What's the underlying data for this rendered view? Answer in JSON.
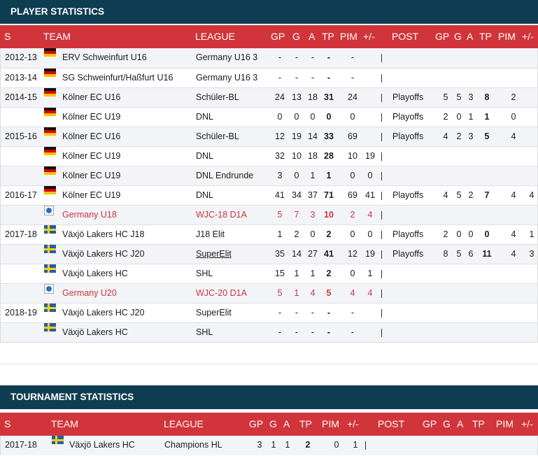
{
  "player_section": {
    "title": "PLAYER STATISTICS",
    "headers": {
      "season": "S",
      "team": "TEAM",
      "league": "LEAGUE",
      "gp": "GP",
      "g": "G",
      "a": "A",
      "tp": "TP",
      "pim": "PIM",
      "pm": "+/-",
      "post": "POST",
      "pgp": "GP",
      "pg": "G",
      "pa": "A",
      "ptp": "TP",
      "ppim": "PIM",
      "ppm": "+/-"
    },
    "rows": [
      {
        "season": "2012-13",
        "flag": "germany-flag",
        "team": "ERV Schweinfurt U16",
        "league": "Germany U16 3",
        "gp": "-",
        "g": "-",
        "a": "-",
        "tp": "-",
        "pim": "-",
        "pm": "",
        "sep": "|",
        "post": "",
        "pgp": "",
        "pg": "",
        "pa": "",
        "ptp": "",
        "ppim": "",
        "ppm": "",
        "red": false
      },
      {
        "season": "2013-14",
        "flag": "germany-flag",
        "team": "SG Schweinfurt/Haßfurt U16",
        "league": "Germany U16 3",
        "gp": "-",
        "g": "-",
        "a": "-",
        "tp": "-",
        "pim": "-",
        "pm": "",
        "sep": "|",
        "post": "",
        "pgp": "",
        "pg": "",
        "pa": "",
        "ptp": "",
        "ppim": "",
        "ppm": "",
        "red": false
      },
      {
        "season": "2014-15",
        "flag": "germany-flag",
        "team": "Kölner EC U16",
        "league": "Schüler-BL",
        "gp": "24",
        "g": "13",
        "a": "18",
        "tp": "31",
        "pim": "24",
        "pm": "",
        "sep": "|",
        "post": "Playoffs",
        "pgp": "5",
        "pg": "5",
        "pa": "3",
        "ptp": "8",
        "ppim": "2",
        "ppm": "",
        "red": false
      },
      {
        "season": "",
        "flag": "germany-flag",
        "team": "Kölner EC U19",
        "league": "DNL",
        "gp": "0",
        "g": "0",
        "a": "0",
        "tp": "0",
        "pim": "0",
        "pm": "",
        "sep": "|",
        "post": "Playoffs",
        "pgp": "2",
        "pg": "0",
        "pa": "1",
        "ptp": "1",
        "ppim": "0",
        "ppm": "",
        "red": false
      },
      {
        "season": "2015-16",
        "flag": "germany-flag",
        "team": "Kölner EC U16",
        "league": "Schüler-BL",
        "gp": "12",
        "g": "19",
        "a": "14",
        "tp": "33",
        "pim": "69",
        "pm": "",
        "sep": "|",
        "post": "Playoffs",
        "pgp": "4",
        "pg": "2",
        "pa": "3",
        "ptp": "5",
        "ppim": "4",
        "ppm": "",
        "red": false
      },
      {
        "season": "",
        "flag": "germany-flag",
        "team": "Kölner EC U19",
        "league": "DNL",
        "gp": "32",
        "g": "10",
        "a": "18",
        "tp": "28",
        "pim": "10",
        "pm": "19",
        "sep": "|",
        "post": "",
        "pgp": "",
        "pg": "",
        "pa": "",
        "ptp": "",
        "ppim": "",
        "ppm": "",
        "red": false
      },
      {
        "season": "",
        "flag": "germany-flag",
        "team": "Kölner EC U19",
        "league": "DNL Endrunde",
        "gp": "3",
        "g": "0",
        "a": "1",
        "tp": "1",
        "pim": "0",
        "pm": "0",
        "sep": "|",
        "post": "",
        "pgp": "",
        "pg": "",
        "pa": "",
        "ptp": "",
        "ppim": "",
        "ppm": "",
        "red": false
      },
      {
        "season": "2016-17",
        "flag": "germany-flag",
        "team": "Kölner EC U19",
        "league": "DNL",
        "gp": "41",
        "g": "34",
        "a": "37",
        "tp": "71",
        "pim": "69",
        "pm": "41",
        "sep": "|",
        "post": "Playoffs",
        "pgp": "4",
        "pg": "5",
        "pa": "2",
        "ptp": "7",
        "ppim": "4",
        "ppm": "4",
        "red": false
      },
      {
        "season": "",
        "flag": "international-flag",
        "team": "Germany U18",
        "league": "WJC-18 D1A",
        "gp": "5",
        "g": "7",
        "a": "3",
        "tp": "10",
        "pim": "2",
        "pm": "4",
        "sep": "|",
        "post": "",
        "pgp": "",
        "pg": "",
        "pa": "",
        "ptp": "",
        "ppim": "",
        "ppm": "",
        "red": true
      },
      {
        "season": "2017-18",
        "flag": "sweden-flag",
        "team": "Växjö Lakers HC J18",
        "league": "J18 Elit",
        "gp": "1",
        "g": "2",
        "a": "0",
        "tp": "2",
        "pim": "0",
        "pm": "0",
        "sep": "|",
        "post": "Playoffs",
        "pgp": "2",
        "pg": "0",
        "pa": "0",
        "ptp": "0",
        "ppim": "4",
        "ppm": "1",
        "red": false
      },
      {
        "season": "",
        "flag": "sweden-flag",
        "team": "Växjö Lakers HC J20",
        "league": "SuperElit",
        "gp": "35",
        "g": "14",
        "a": "27",
        "tp": "41",
        "pim": "12",
        "pm": "19",
        "sep": "|",
        "post": "Playoffs",
        "pgp": "8",
        "pg": "5",
        "pa": "6",
        "ptp": "11",
        "ppim": "4",
        "ppm": "3",
        "red": false,
        "league_underline": true
      },
      {
        "season": "",
        "flag": "sweden-flag",
        "team": "Växjö Lakers HC",
        "league": "SHL",
        "gp": "15",
        "g": "1",
        "a": "1",
        "tp": "2",
        "pim": "0",
        "pm": "1",
        "sep": "|",
        "post": "",
        "pgp": "",
        "pg": "",
        "pa": "",
        "ptp": "",
        "ppim": "",
        "ppm": "",
        "red": false
      },
      {
        "season": "",
        "flag": "international-flag",
        "team": "Germany U20",
        "league": "WJC-20 D1A",
        "gp": "5",
        "g": "1",
        "a": "4",
        "tp": "5",
        "pim": "4",
        "pm": "4",
        "sep": "|",
        "post": "",
        "pgp": "",
        "pg": "",
        "pa": "",
        "ptp": "",
        "ppim": "",
        "ppm": "",
        "red": true
      },
      {
        "season": "2018-19",
        "flag": "sweden-flag",
        "team": "Växjö Lakers HC J20",
        "league": "SuperElit",
        "gp": "-",
        "g": "-",
        "a": "-",
        "tp": "-",
        "pim": "-",
        "pm": "",
        "sep": "|",
        "post": "",
        "pgp": "",
        "pg": "",
        "pa": "",
        "ptp": "",
        "ppim": "",
        "ppm": "",
        "red": false
      },
      {
        "season": "",
        "flag": "sweden-flag",
        "team": "Växjö Lakers HC",
        "league": "SHL",
        "gp": "-",
        "g": "-",
        "a": "-",
        "tp": "-",
        "pim": "-",
        "pm": "",
        "sep": "|",
        "post": "",
        "pgp": "",
        "pg": "",
        "pa": "",
        "ptp": "",
        "ppim": "",
        "ppm": "",
        "red": false
      }
    ]
  },
  "tournament_section": {
    "title": "TOURNAMENT STATISTICS",
    "headers": {
      "season": "S",
      "team": "TEAM",
      "league": "LEAGUE",
      "gp": "GP",
      "g": "G",
      "a": "A",
      "tp": "TP",
      "pim": "PIM",
      "pm": "+/-",
      "post": "POST",
      "pgp": "GP",
      "pg": "G",
      "pa": "A",
      "ptp": "TP",
      "ppim": "PIM",
      "ppm": "+/-"
    },
    "rows": [
      {
        "season": "2017-18",
        "flag": "sweden-flag",
        "team": "Växjö Lakers HC",
        "league": "Champions HL",
        "gp": "3",
        "g": "1",
        "a": "1",
        "tp": "2",
        "pim": "0",
        "pm": "1",
        "sep": "|",
        "post": "",
        "pgp": "",
        "pg": "",
        "pa": "",
        "ptp": "",
        "ppim": "",
        "ppm": "",
        "red": false
      }
    ]
  },
  "colors": {
    "title_bar": "#0f3e52",
    "header_bar": "#d1343a",
    "accent_red": "#d1343a"
  }
}
